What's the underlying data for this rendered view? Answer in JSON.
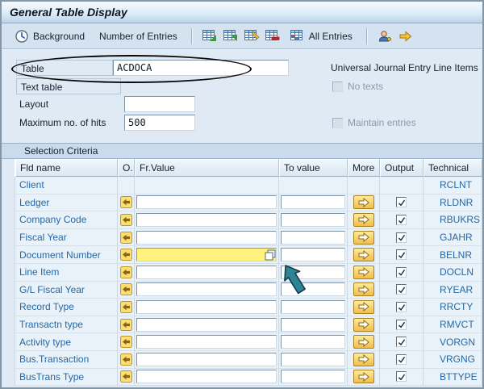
{
  "title": "General Table Display",
  "toolbar": {
    "background": "Background",
    "number_of_entries": "Number of Entries",
    "all_entries": "All Entries"
  },
  "form": {
    "table": {
      "label": "Table",
      "value": "ACDOCA",
      "description": "Universal Journal Entry Line Items"
    },
    "text_table": {
      "label": "Text table"
    },
    "layout": {
      "label": "Layout",
      "value": ""
    },
    "max_hits": {
      "label": "Maximum no. of hits",
      "value": "500"
    },
    "no_texts": {
      "label": "No texts",
      "checked": false
    },
    "maintain_entries": {
      "label": "Maintain entries",
      "checked": false
    }
  },
  "selection": {
    "header": "Selection Criteria",
    "columns": {
      "fld": "Fld name",
      "o": "O.",
      "fr": "Fr.Value",
      "to": "To value",
      "more": "More",
      "output": "Output",
      "technical": "Technical"
    },
    "rows": [
      {
        "field": "Client",
        "technical": "RCLNT",
        "controls": false,
        "active": false,
        "output_checked": false
      },
      {
        "field": "Ledger",
        "technical": "RLDNR",
        "controls": true,
        "active": false,
        "output_checked": true
      },
      {
        "field": "Company Code",
        "technical": "RBUKRS",
        "controls": true,
        "active": false,
        "output_checked": true
      },
      {
        "field": "Fiscal Year",
        "technical": "GJAHR",
        "controls": true,
        "active": false,
        "output_checked": true
      },
      {
        "field": "Document Number",
        "technical": "BELNR",
        "controls": true,
        "active": true,
        "output_checked": true
      },
      {
        "field": "Line Item",
        "technical": "DOCLN",
        "controls": true,
        "active": false,
        "output_checked": true
      },
      {
        "field": "G/L Fiscal Year",
        "technical": "RYEAR",
        "controls": true,
        "active": false,
        "output_checked": true
      },
      {
        "field": "Record Type",
        "technical": "RRCTY",
        "controls": true,
        "active": false,
        "output_checked": true
      },
      {
        "field": "Transactn type",
        "technical": "RMVCT",
        "controls": true,
        "active": false,
        "output_checked": true
      },
      {
        "field": "Activity type",
        "technical": "VORGN",
        "controls": true,
        "active": false,
        "output_checked": true
      },
      {
        "field": "Bus.Transaction",
        "technical": "VRGNG",
        "controls": true,
        "active": false,
        "output_checked": true
      },
      {
        "field": "BusTrans Type",
        "technical": "BTTYPE",
        "controls": true,
        "active": false,
        "output_checked": true
      }
    ]
  },
  "icons": [
    "clock-icon",
    "table-choose-icon",
    "table-insert-icon",
    "table-edit-icon",
    "table-delete-icon",
    "all-entries-icon",
    "user-icon",
    "exit-icon",
    "multiple-selection-icon",
    "more-arrow-icon",
    "copy-values-icon",
    "cursor-arrow-annotation",
    "circle-annotation"
  ],
  "colors": {
    "link_blue": "#2268a8",
    "active_field_yellow": "#fff27d",
    "more_button_yellow": "#f1bd4c",
    "annotation_teal": "#2e8494",
    "annotation_black": "#000000",
    "window_background": "#e0eaf4"
  }
}
